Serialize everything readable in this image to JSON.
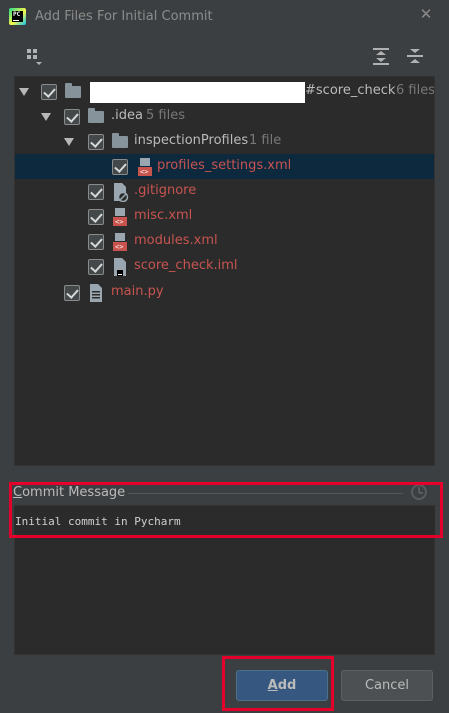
{
  "window": {
    "title": "Add Files For Initial Commit",
    "close_glyph": "✕"
  },
  "toolbar": {
    "group_icon": "group-by-icon",
    "expand_icon": "expand-all-icon",
    "collapse_icon": "collapse-all-icon"
  },
  "tree": {
    "root": {
      "name": "#score_check",
      "count": "6 files",
      "checked": true,
      "expanded": true
    },
    "idea": {
      "name": ".idea",
      "count": "5 files",
      "checked": true,
      "expanded": true
    },
    "inspection": {
      "name": "inspectionProfiles",
      "count": "1 file",
      "checked": true,
      "expanded": true
    },
    "files": [
      {
        "name": "profiles_settings.xml",
        "checked": true,
        "icon": "xml-file-icon",
        "selected": true
      },
      {
        "name": ".gitignore",
        "checked": true,
        "icon": "ignore-file-icon"
      },
      {
        "name": "misc.xml",
        "checked": true,
        "icon": "xml-file-icon"
      },
      {
        "name": "modules.xml",
        "checked": true,
        "icon": "xml-file-icon"
      },
      {
        "name": "score_check.iml",
        "checked": true,
        "icon": "iml-file-icon"
      },
      {
        "name": "main.py",
        "checked": true,
        "icon": "python-file-icon"
      }
    ]
  },
  "commit": {
    "label_first": "C",
    "label_rest": "ommit Message",
    "message": "Initial commit in Pycharm"
  },
  "buttons": {
    "add_first": "A",
    "add_rest": "dd",
    "cancel": "Cancel"
  },
  "colors": {
    "accent": "#365880",
    "highlight": "#e4002b",
    "unversioned_text": "#c75450",
    "selection": "#0d293e"
  }
}
